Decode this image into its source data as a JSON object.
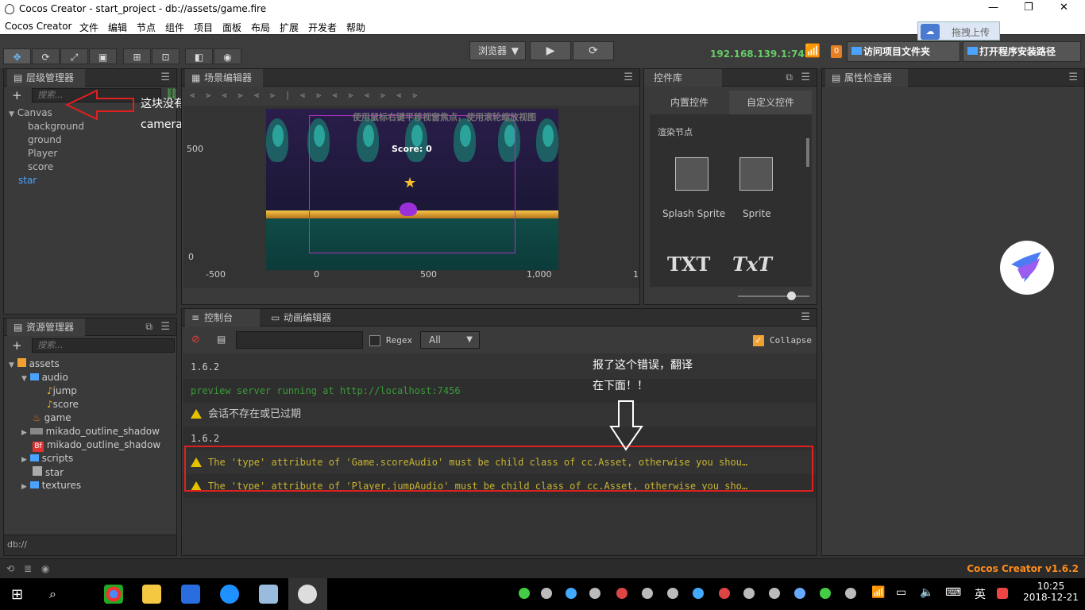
{
  "window": {
    "title": "Cocos Creator - start_project - db://assets/game.fire"
  },
  "menu": [
    "Cocos Creator",
    "文件",
    "编辑",
    "节点",
    "组件",
    "项目",
    "面板",
    "布局",
    "扩展",
    "开发者",
    "帮助"
  ],
  "toolbar": {
    "browser_label": "浏览器",
    "ip": "192.168.139.1:7456",
    "badge": "0",
    "open_project_label": "访问项目文件夹",
    "open_install_label": "打开程序安装路径",
    "upload_label": "拖拽上传"
  },
  "hierarchy": {
    "title": "层级管理器",
    "search_placeholder": "搜索...",
    "nodes": [
      "Canvas",
      "background",
      "ground",
      "Player",
      "score",
      "star"
    ]
  },
  "scene": {
    "title": "场景编辑器",
    "hint": "使用鼠标右键平移视窗焦点，使用滚轮缩放视图",
    "y_labels": [
      "500",
      "0"
    ],
    "x_labels": [
      "-500",
      "0",
      "500",
      "1,000",
      "1"
    ],
    "score_text": "Score: 0"
  },
  "widgets": {
    "title": "控件库",
    "tab_builtin": "内置控件",
    "tab_custom": "自定义控件",
    "section": "渲染节点",
    "items": [
      "Splash Sprite",
      "Sprite"
    ],
    "text_items": [
      "TXT",
      "TxT"
    ]
  },
  "inspector": {
    "title": "属性检查器"
  },
  "assets": {
    "title": "资源管理器",
    "search_placeholder": "搜索...",
    "items": [
      "assets",
      "audio",
      "jump",
      "score",
      "game",
      "mikado_outline_shadow",
      "mikado_outline_shadow",
      "scripts",
      "star",
      "textures"
    ],
    "footer": "db://"
  },
  "console": {
    "tab_console": "控制台",
    "tab_anim": "动画编辑器",
    "regex_label": "Regex",
    "filter_value": "All",
    "collapse_label": "Collapse",
    "rows": [
      {
        "text": "1.6.2"
      },
      {
        "text": "preview server running at http://localhost:7456"
      },
      {
        "text": "会话不存在或已过期"
      },
      {
        "text": "1.6.2"
      },
      {
        "text": "The 'type' attribute of 'Game.scoreAudio' must be child class of cc.Asset, otherwise you shou…"
      },
      {
        "text": "The 'type' attribute of 'Player.jumpAudio' must be child class of cc.Asset, otherwise you sho…"
      }
    ]
  },
  "annotations": {
    "camera_note_1": "这块没有main",
    "camera_note_2": "camera？？",
    "error_note_1": "报了这个错误，翻译",
    "error_note_2": "在下面！！"
  },
  "status": {
    "version": "Cocos Creator v1.6.2"
  },
  "taskbar": {
    "time": "10:25",
    "date": "2018-12-21",
    "ime": "英"
  },
  "colors": {
    "accent_blue": "#4aa3ff",
    "warning": "#e5c100",
    "error_box": "#e02020",
    "ip_green": "#66cc66",
    "version_orange": "#ff8c1a"
  }
}
